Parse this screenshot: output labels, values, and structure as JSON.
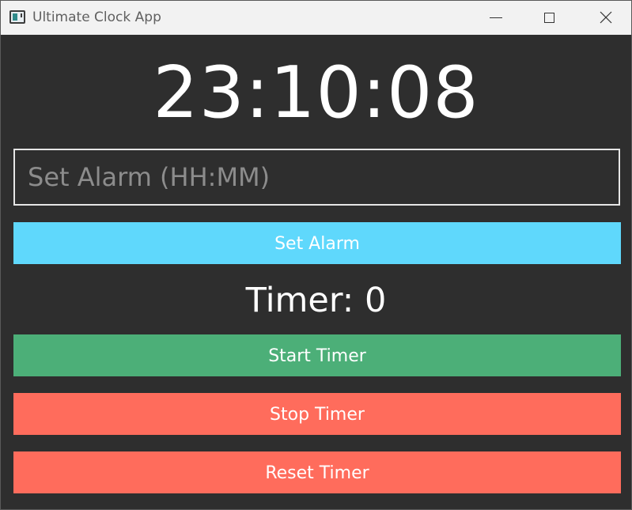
{
  "window": {
    "title": "Ultimate Clock App",
    "icon": "app-window-icon"
  },
  "titlebar_controls": {
    "minimize_icon": "minimize-icon",
    "maximize_icon": "maximize-icon",
    "close_icon": "close-icon"
  },
  "clock": {
    "time": "23:10:08"
  },
  "alarm": {
    "placeholder": "Set Alarm (HH:MM)",
    "value": "",
    "button_label": "Set Alarm",
    "button_color": "#5fd8fc"
  },
  "timer": {
    "label": "Timer: 0",
    "start_label": "Start Timer",
    "stop_label": "Stop Timer",
    "reset_label": "Reset Timer",
    "start_color": "#4caf78",
    "stop_color": "#ff6c5c",
    "reset_color": "#ff6c5c"
  },
  "theme": {
    "background": "#2e2e2e",
    "text": "#ffffff"
  }
}
